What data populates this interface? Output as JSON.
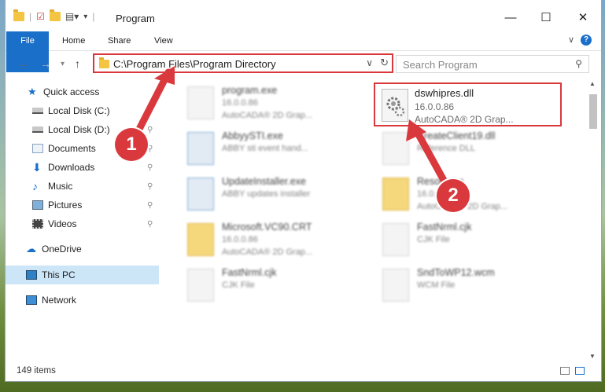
{
  "window": {
    "title": "Program",
    "minimize": "—",
    "maximize": "☐",
    "close": "✕"
  },
  "ribbon": {
    "tabs": [
      "File",
      "Home",
      "Share",
      "View"
    ],
    "help": "?"
  },
  "nav": {
    "back": "←",
    "forward": "→",
    "up": "↑",
    "address": "C:\\Program Files\\Program Directory",
    "search_placeholder": "Search Program"
  },
  "sidebar": {
    "items": [
      {
        "label": "Quick access",
        "icon": "star-icon"
      },
      {
        "label": "Local Disk (C:)",
        "icon": "drive-icon"
      },
      {
        "label": "Local Disk (D:)",
        "icon": "drive-icon"
      },
      {
        "label": "Documents",
        "icon": "documents-icon"
      },
      {
        "label": "Downloads",
        "icon": "download-icon"
      },
      {
        "label": "Music",
        "icon": "music-icon"
      },
      {
        "label": "Pictures",
        "icon": "pictures-icon"
      },
      {
        "label": "Videos",
        "icon": "videos-icon"
      },
      {
        "label": "OneDrive",
        "icon": "cloud-icon"
      },
      {
        "label": "This PC",
        "icon": "computer-icon"
      },
      {
        "label": "Network",
        "icon": "network-icon"
      }
    ]
  },
  "files": [
    {
      "name": "program.exe",
      "line2": "16.0.0.86",
      "line3": "AutoCADA® 2D Grap..."
    },
    {
      "name": "AbbyySTI.exe",
      "line2": "ABBY sti event hand...",
      "line3": ""
    },
    {
      "name": "UpdateInstaller.exe",
      "line2": "ABBY updates installer",
      "line3": ""
    },
    {
      "name": "Microsoft.VC90.CRT",
      "line2": "16.0.0.86",
      "line3": "AutoCADA® 2D Grap..."
    },
    {
      "name": "FastNrml.cjk",
      "line2": "CJK File",
      "line3": ""
    },
    {
      "name": "dswhipres.dll",
      "line2": "16.0.0.86",
      "line3": "AutoCADA® 2D Grap..."
    },
    {
      "name": "CreateClient19.dll",
      "line2": "Reference DLL",
      "line3": ""
    },
    {
      "name": "Resources",
      "line2": "16.0.0.86",
      "line3": "AutoCADA® 2D Grap..."
    },
    {
      "name": "FastNrml.cjk",
      "line2": "CJK File",
      "line3": ""
    },
    {
      "name": "SndToWP12.wcm",
      "line2": "WCM File",
      "line3": ""
    }
  ],
  "status": {
    "items": "149 items"
  },
  "annotations": {
    "step1": "1",
    "step2": "2",
    "highlight_color": "#d9393d"
  }
}
